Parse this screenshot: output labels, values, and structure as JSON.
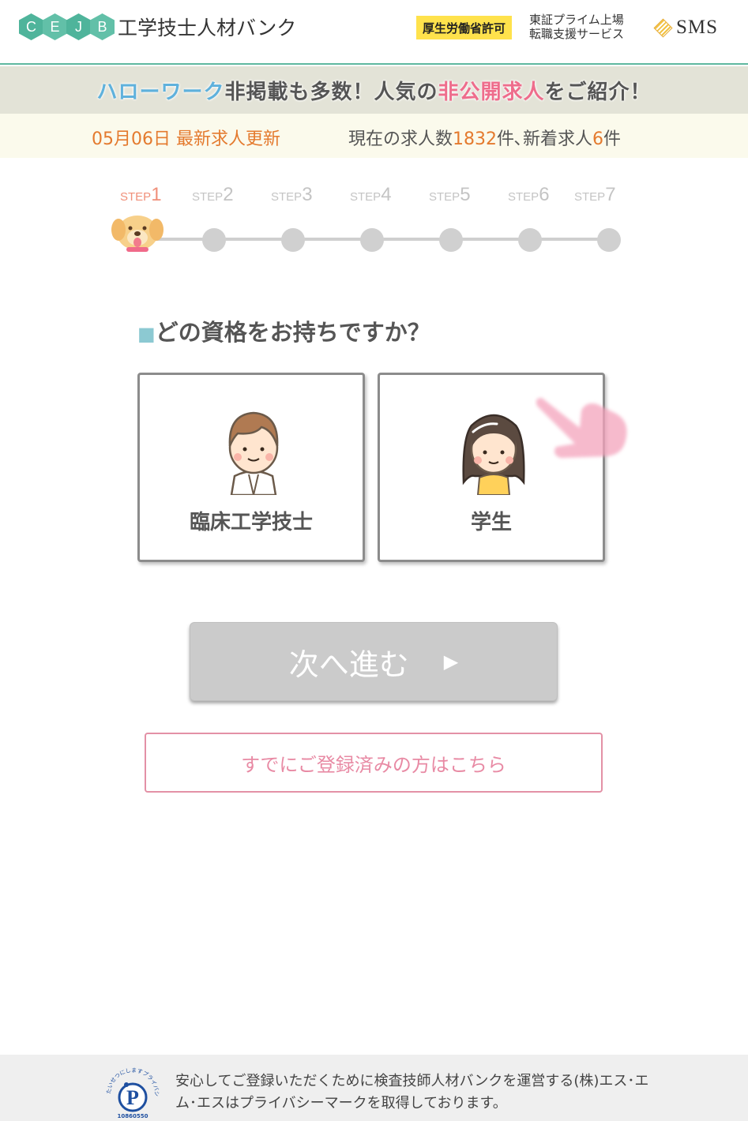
{
  "header": {
    "logo_letters": [
      "C",
      "E",
      "J",
      "B"
    ],
    "logo_name": "工学技士人材バンク",
    "license": "厚生労働省許可",
    "listing_line1": "東証プライム上場",
    "listing_line2": "転職支援サービス",
    "company": "SMS"
  },
  "banner": {
    "part1": "ハローワーク",
    "part2": "非掲載も多数！人気の",
    "part3": "非公開求人",
    "part4": "をご紹介！"
  },
  "info": {
    "update": "05月06日 最新求人更新",
    "count_prefix": "現在の求人数",
    "count_total": "1832",
    "count_mid": "件､新着求人",
    "count_new": "6",
    "count_suffix": "件"
  },
  "steps": [
    {
      "prefix": "STEP",
      "num": "1",
      "active": true
    },
    {
      "prefix": "STEP",
      "num": "2",
      "active": false
    },
    {
      "prefix": "STEP",
      "num": "3",
      "active": false
    },
    {
      "prefix": "STEP",
      "num": "4",
      "active": false
    },
    {
      "prefix": "STEP",
      "num": "5",
      "active": false
    },
    {
      "prefix": "STEP",
      "num": "6",
      "active": false
    },
    {
      "prefix": "STEP",
      "num": "7",
      "active": false
    }
  ],
  "question": {
    "marker": "■",
    "text": "どの資格をお持ちですか？"
  },
  "choices": [
    {
      "label": "臨床工学技士",
      "icon": "engineer-avatar-icon"
    },
    {
      "label": "学生",
      "icon": "student-avatar-icon"
    }
  ],
  "next_button": {
    "label": "次へ進む",
    "arrow": "▶"
  },
  "login_button": {
    "label": "すでにご登録済みの方はこちら"
  },
  "footer": {
    "text": "安心してご登録いただくために検査技師人材バンクを運営する(株)エス･エム･エスはプライバシーマークを取得しております。",
    "pmark_caption": "たいせつにしますプライバシー",
    "pmark_number": "10860550"
  },
  "colors": {
    "brand_green": "#4fb49b",
    "accent_orange": "#e47a2e",
    "accent_pink": "#ee6d8c",
    "button_gray": "#cbcbcb"
  }
}
